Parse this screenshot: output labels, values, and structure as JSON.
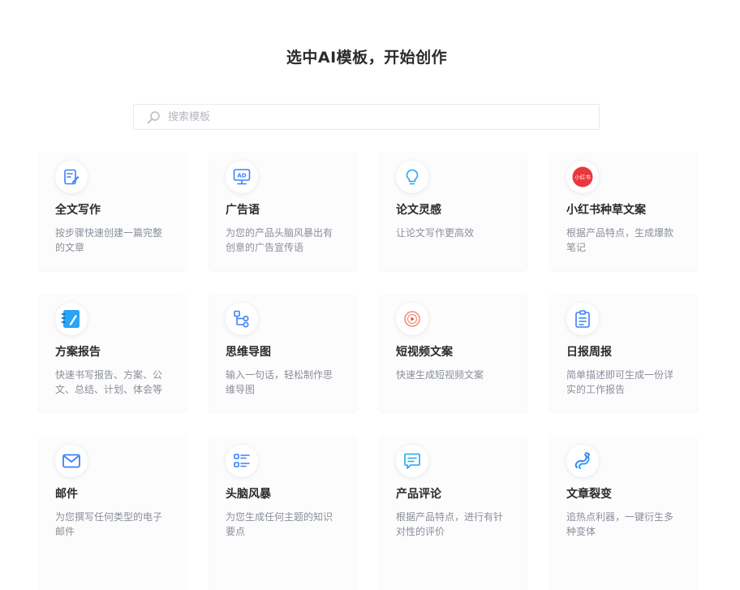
{
  "page": {
    "title": "选中AI模板，开始创作"
  },
  "search": {
    "placeholder": "搜索模板"
  },
  "templates": [
    {
      "title": "全文写作",
      "desc": "按步骤快速创建一篇完整的文章",
      "icon": "document-edit-icon"
    },
    {
      "title": "广告语",
      "desc": "为您的产品头脑风暴出有创意的广告宣传语",
      "icon": "ad-monitor-icon"
    },
    {
      "title": "论文灵感",
      "desc": "让论文写作更高效",
      "icon": "lightbulb-icon"
    },
    {
      "title": "小红书种草文案",
      "desc": "根据产品特点，生成爆款笔记",
      "icon": "xiaohongshu-logo-icon",
      "icon_text": "小红书"
    },
    {
      "title": "方案报告",
      "desc": "快速书写报告、方案、公文、总结、计划、体会等",
      "icon": "notebook-pen-icon"
    },
    {
      "title": "思维导图",
      "desc": "输入一句话，轻松制作思维导图",
      "icon": "mind-map-icon"
    },
    {
      "title": "短视频文案",
      "desc": "快速生成短视频文案",
      "icon": "video-play-icon"
    },
    {
      "title": "日报周报",
      "desc": "简单描述即可生成一份详实的工作报告",
      "icon": "clipboard-report-icon"
    },
    {
      "title": "邮件",
      "desc": "为您撰写任何类型的电子邮件",
      "icon": "mail-icon"
    },
    {
      "title": "头脑风暴",
      "desc": "为您生成任何主题的知识要点",
      "icon": "brainstorm-list-icon"
    },
    {
      "title": "产品评论",
      "desc": "根据产品特点，进行有针对性的评价",
      "icon": "comment-icon"
    },
    {
      "title": "文章裂变",
      "desc": "追热点利器，一键衍生多种变体",
      "icon": "article-split-icon"
    }
  ],
  "colors": {
    "accent_blue": "#3b82f6",
    "light_blue": "#22a6f2",
    "brand_red": "#e8383d",
    "video_orange": "#f0907a"
  }
}
